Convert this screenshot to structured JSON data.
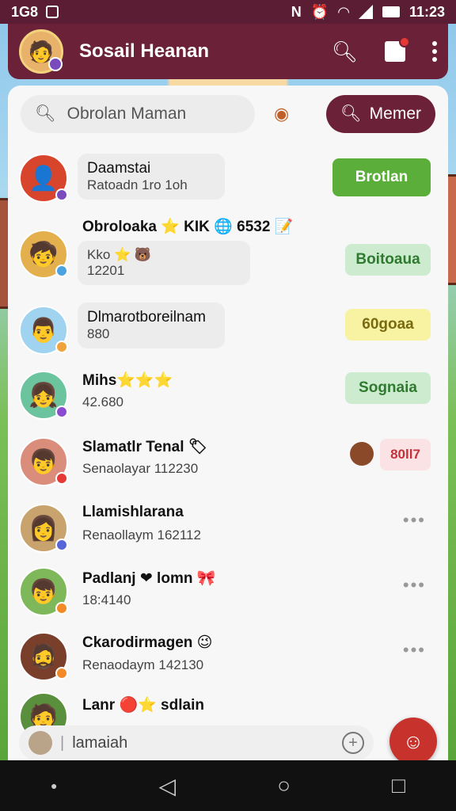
{
  "status": {
    "left": "1G8",
    "time": "11:23"
  },
  "header": {
    "title": "Sosail Heanan"
  },
  "search": {
    "placeholder": "Obrolan Maman"
  },
  "member_button": "Memer",
  "chats": [
    {
      "name": "Daamstai",
      "sub": "Ratoadn 1ro 1oh",
      "tag": "Brotlan",
      "tag_style": "green",
      "avatar_bg": "#d8452d",
      "badge": "#7b4bbd"
    },
    {
      "name": "Obroloaka ⭐ KIK 🌐 6532 📝",
      "sub": "Kko ⭐ 🐻",
      "sub2": "12201",
      "tag": "Boitoaua",
      "tag_style": "lgreen",
      "avatar_bg": "#e4b04e",
      "badge": "#4aa3e0"
    },
    {
      "name": "Dlmarotboreilnam",
      "sub": "880",
      "tag": "60goaa",
      "tag_style": "yellow",
      "avatar_bg": "#9fd3f0",
      "badge": "#f0a33a"
    },
    {
      "name": "Mihs⭐⭐⭐",
      "sub": "42.680",
      "tag": "Sognaia",
      "tag_style": "lgreen",
      "avatar_bg": "#6cc49f",
      "badge": "#8a4bd0"
    },
    {
      "name": "Slamatlr Tenal 🏷",
      "sub": "Senaolayar 112230",
      "tag": "80ll7",
      "tag_style": "pink",
      "avatar_bg": "#d98d7a",
      "badge": "#e53935"
    },
    {
      "name": "Llamishlarana",
      "sub": "Renaollaym 162112",
      "avatar_bg": "#c9a36e",
      "badge": "#5865d6"
    },
    {
      "name": "Padlanj ❤ lomn 🎀",
      "sub": "18:4140",
      "avatar_bg": "#7fb85a",
      "badge": "#f28a2a"
    },
    {
      "name": "Ckarodirmagen 😉",
      "sub": "Renaodaym 142130",
      "avatar_bg": "#7a3f2a",
      "badge": "#f28a2a"
    },
    {
      "name": "Lanr 🔴⭐ sdlain",
      "sub": "",
      "avatar_bg": "#5a8f3d",
      "badge": "#f28a2a"
    }
  ],
  "input": {
    "placeholder": "lamaiah"
  }
}
